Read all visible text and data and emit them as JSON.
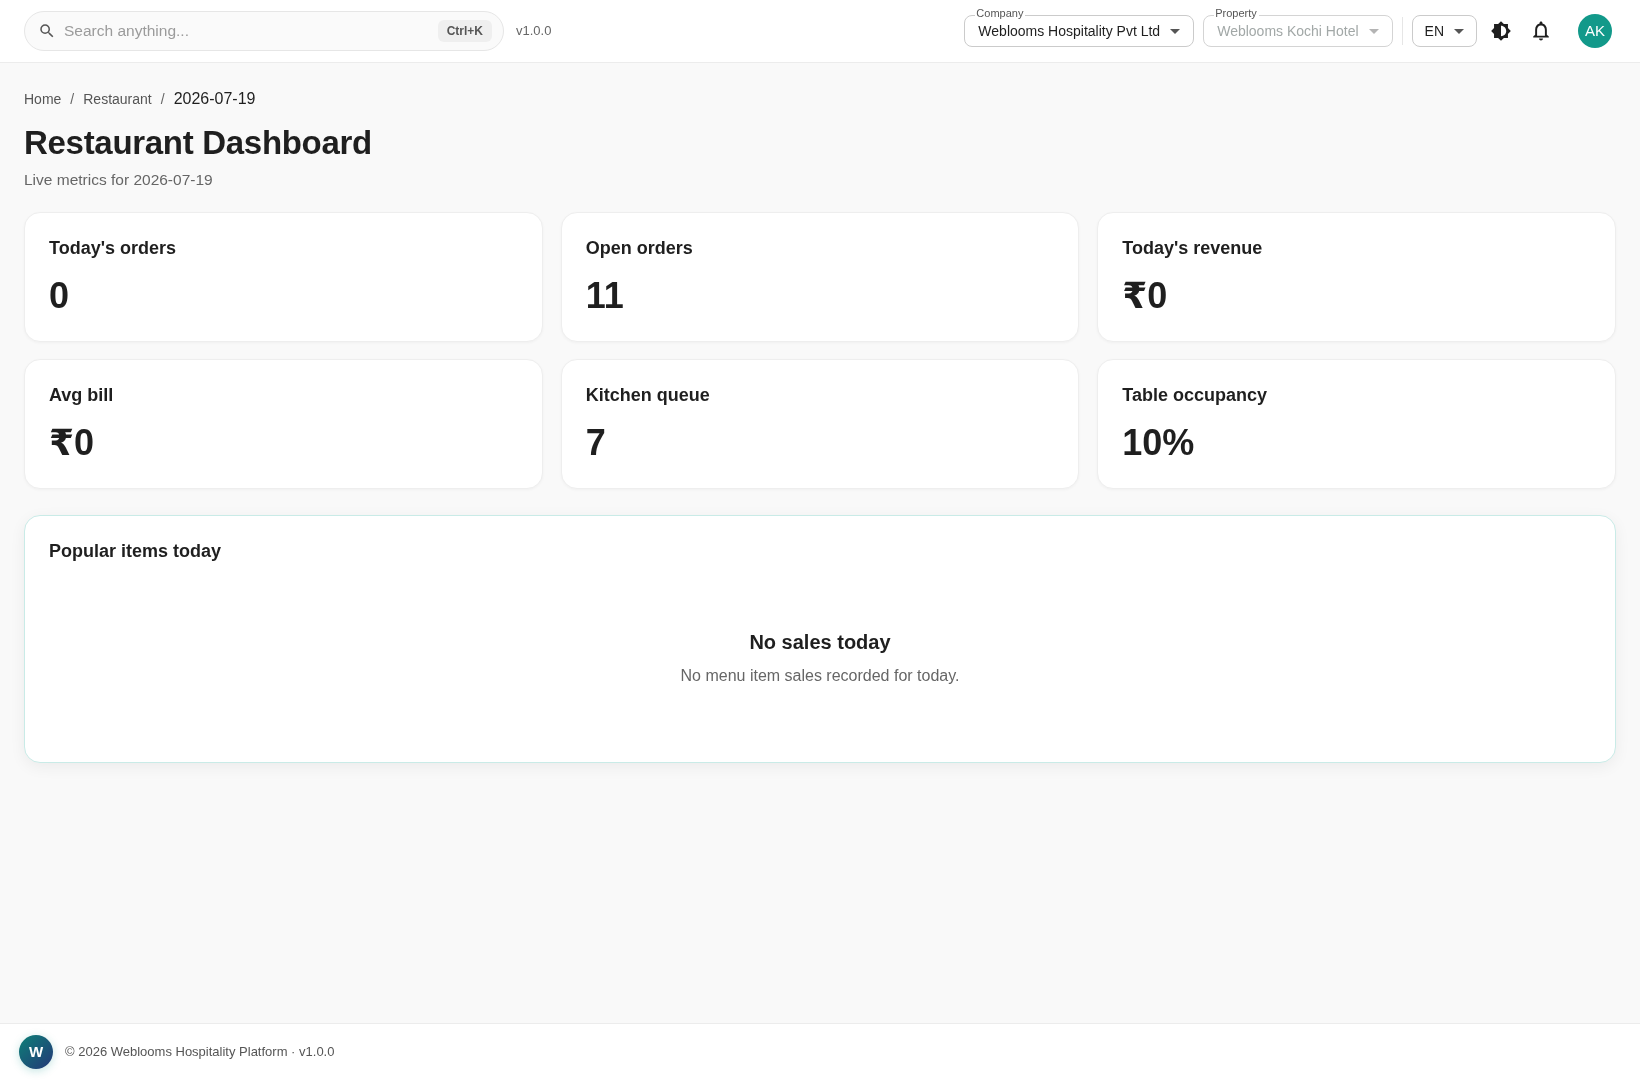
{
  "topbar": {
    "search": {
      "placeholder": "Search anything...",
      "shortcut": "Ctrl+K"
    },
    "version": "v1.0.0",
    "selects": [
      {
        "label": "Company",
        "value": "Weblooms Hospitality Pvt Ltd",
        "disabled": false
      },
      {
        "label": "Property",
        "value": "Weblooms Kochi Hotel",
        "disabled": true
      }
    ],
    "language": "EN",
    "avatar": "AK"
  },
  "breadcrumb": [
    {
      "label": "Home",
      "current": false
    },
    {
      "separator": "/",
      "label": "Restaurant",
      "current": false
    },
    {
      "separator": "/",
      "label": "2026-07-19",
      "current": true
    }
  ],
  "page": {
    "title": "Restaurant Dashboard",
    "subtitle": "Live metrics for 2026-07-19"
  },
  "metrics": [
    {
      "label": "Today's orders",
      "value": "0"
    },
    {
      "label": "Open orders",
      "value": "11"
    },
    {
      "label": "Today's revenue",
      "value": "₹0"
    },
    {
      "label": "Avg bill",
      "value": "₹0"
    },
    {
      "label": "Kitchen queue",
      "value": "7"
    },
    {
      "label": "Table occupancy",
      "value": "10%"
    }
  ],
  "popular_items": {
    "title": "Popular items today",
    "empty_state": {
      "title": "No sales today",
      "text": "No menu item sales recorded for today."
    }
  },
  "footer": {
    "logo": "W",
    "text": "© 2026 Weblooms Hospitality Platform · v1.0.0"
  }
}
